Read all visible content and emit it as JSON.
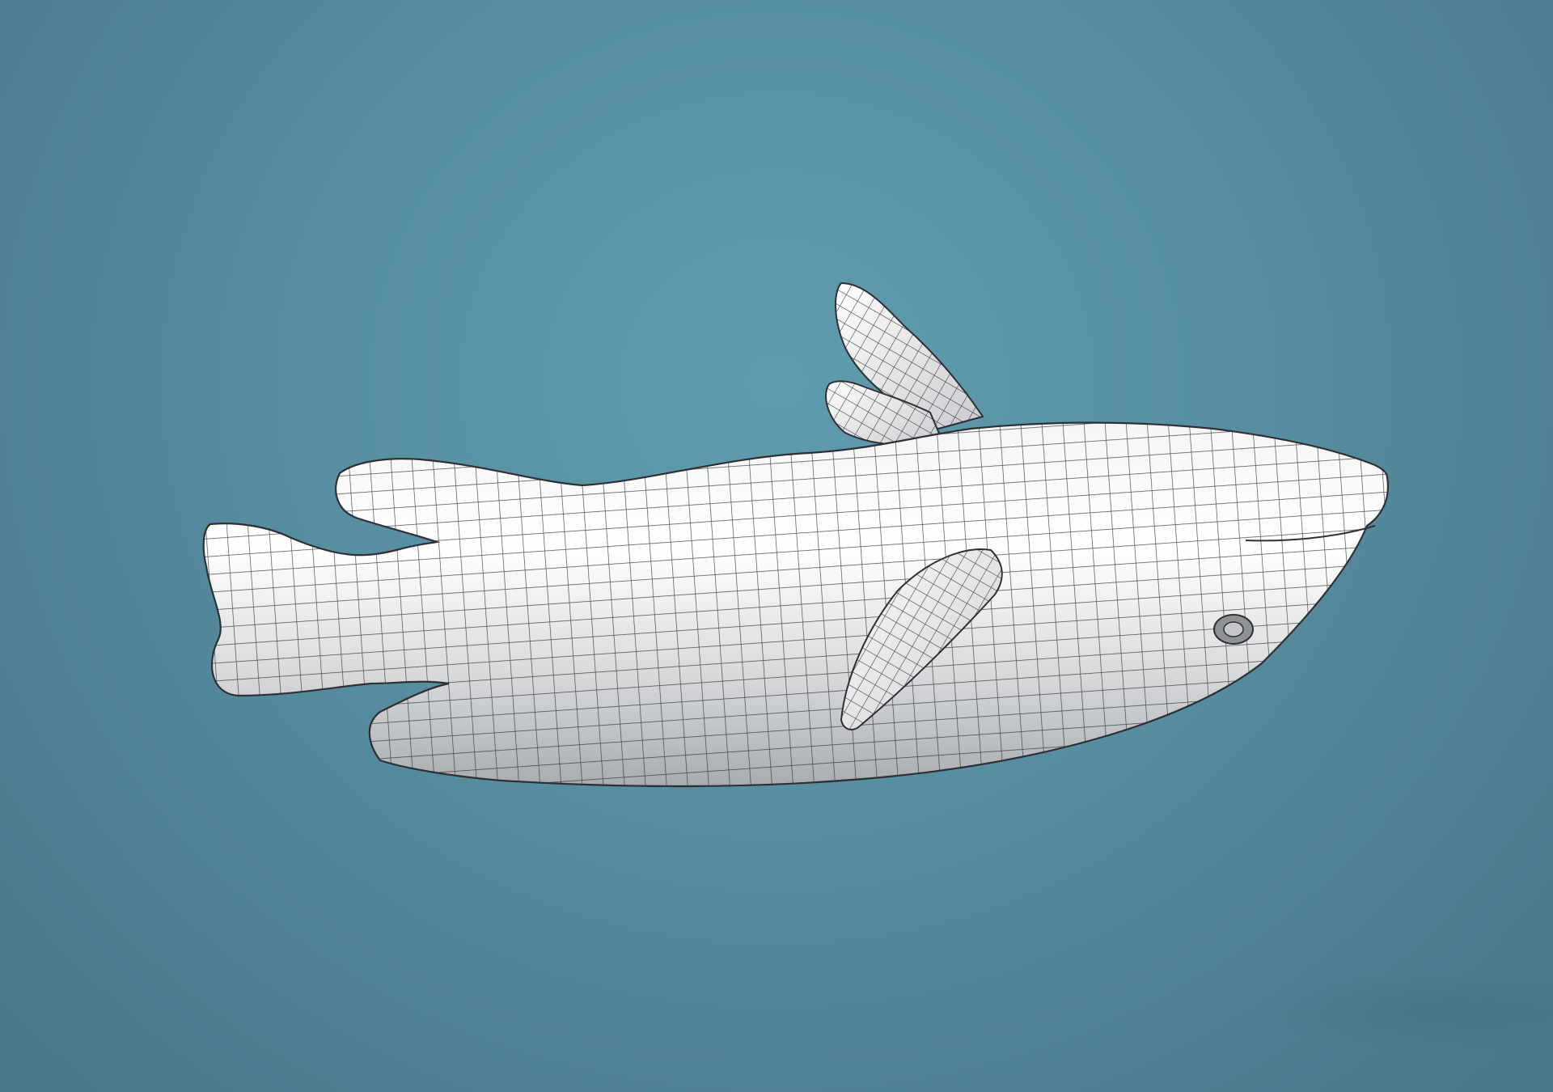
{
  "scene": {
    "subject": "",
    "colors": {
      "background_top": "#5f9bae",
      "background_bottom": "#477789",
      "mesh_fill_light": "#ffffff",
      "mesh_fill_shadow": "#a9acaf",
      "wire": "#2e3033"
    },
    "icons": [
      "fish-model",
      "wireframe-grid"
    ]
  }
}
